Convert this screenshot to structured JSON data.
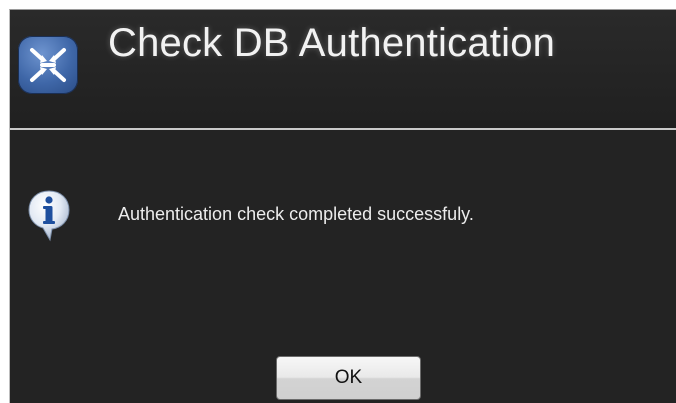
{
  "dialog": {
    "title": "Check DB Authentication",
    "app_icon": "network-sync-icon",
    "message_icon": "info-icon",
    "message": "Authentication check completed successfuly.",
    "ok_label": "OK"
  },
  "colors": {
    "background": "#232323",
    "title_text": "#f2f2f2",
    "icon_blue": "#3f67a8"
  }
}
